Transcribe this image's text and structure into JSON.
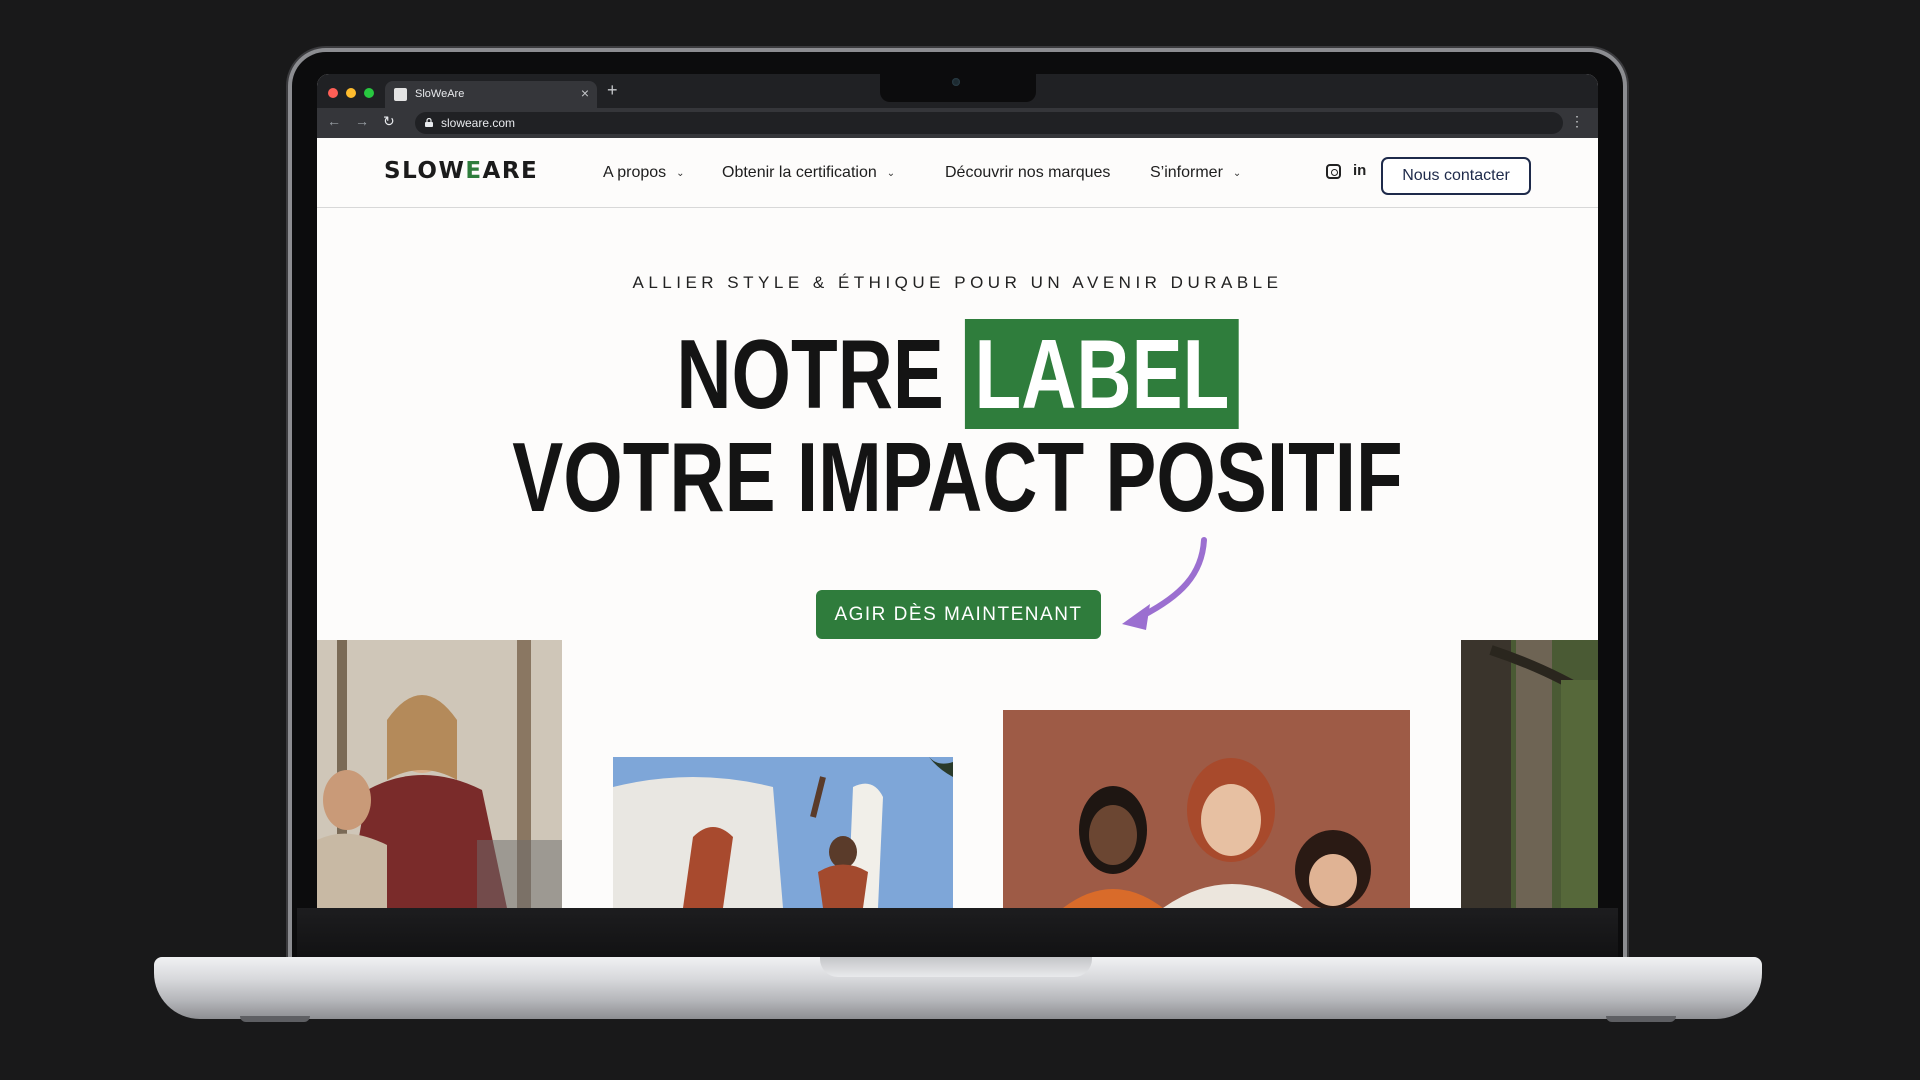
{
  "browser": {
    "tab_title": "SloWeAre",
    "tab_close": "×",
    "new_tab": "+",
    "url": "sloweare.com",
    "back_icon": "←",
    "forward_icon": "→",
    "reload_icon": "↻",
    "menu_icon": "⋮"
  },
  "header": {
    "logo_prefix": "SLOW",
    "logo_accent": "E",
    "logo_suffix": "ARE",
    "nav": {
      "apropos": "A propos",
      "certification": "Obtenir la certification",
      "marques": "Découvrir nos marques",
      "informer": "S’informer"
    },
    "chevron": "⌄",
    "linkedin_icon": "in",
    "contact_label": "Nous contacter"
  },
  "hero": {
    "tagline": "ALLIER STYLE & ÉTHIQUE POUR UN AVENIR DURABLE",
    "headline_line1_prefix": "NOTRE",
    "headline_line1_highlight": "LABEL",
    "headline_line2": "VOTRE IMPACT POSITIF",
    "cta_label": "AGIR DÈS MAINTENANT"
  },
  "colors": {
    "brand_green": "#2f7c3c",
    "arrow_purple": "#9b6fd0",
    "contact_border": "#1e2a4a"
  }
}
